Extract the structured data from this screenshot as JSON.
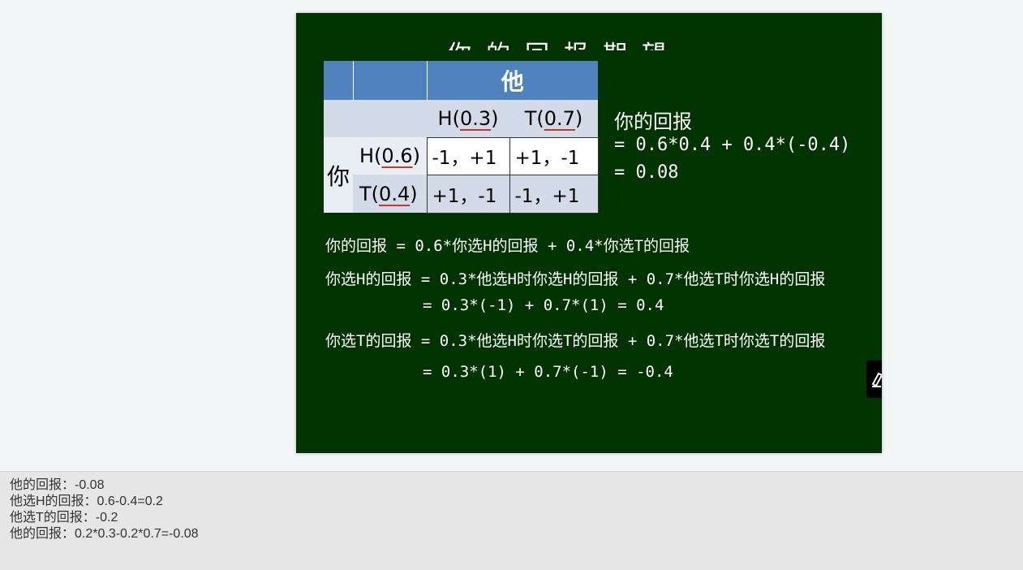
{
  "slide": {
    "title_fragment": "你的回报期望",
    "table": {
      "header_player": "他",
      "col_h": {
        "label": "H",
        "prob": "0.3"
      },
      "col_t": {
        "label": "T",
        "prob": "0.7"
      },
      "row_player": "你",
      "row_h": {
        "label": "H",
        "prob": "0.6",
        "cells": [
          "-1，+1",
          "+1，-1"
        ]
      },
      "row_t": {
        "label": "T",
        "prob": "0.4",
        "cells": [
          "+1，-1",
          "-1，+1"
        ]
      }
    },
    "formula": {
      "title": "你的回报",
      "line1": "= 0.6*0.4 + 0.4*(-0.4)",
      "line2": "= 0.08"
    },
    "equations": [
      "你的回报 = 0.6*你选H的回报 + 0.4*你选T的回报",
      "你选H的回报 = 0.3*他选H时你选H的回报 + 0.7*他选T时你选H的回报",
      "= 0.3*(-1) + 0.7*(1) = 0.4",
      "你选T的回报 = 0.3*他选H时你选T的回报 + 0.7*他选T时你选T的回报",
      "= 0.3*(1) + 0.7*(-1) = -0.4"
    ]
  },
  "notes": [
    "他的回报：-0.08",
    "他选H的回报：0.6-0.4=0.2",
    "他选T的回报：-0.2",
    "他的回报：0.2*0.3-0.2*0.7=-0.08"
  ],
  "icons": {
    "edge_button": "edit-icon"
  },
  "colors": {
    "slide_bg": "#003300",
    "table_header": "#4f81bd",
    "underline": "#c0392b"
  }
}
